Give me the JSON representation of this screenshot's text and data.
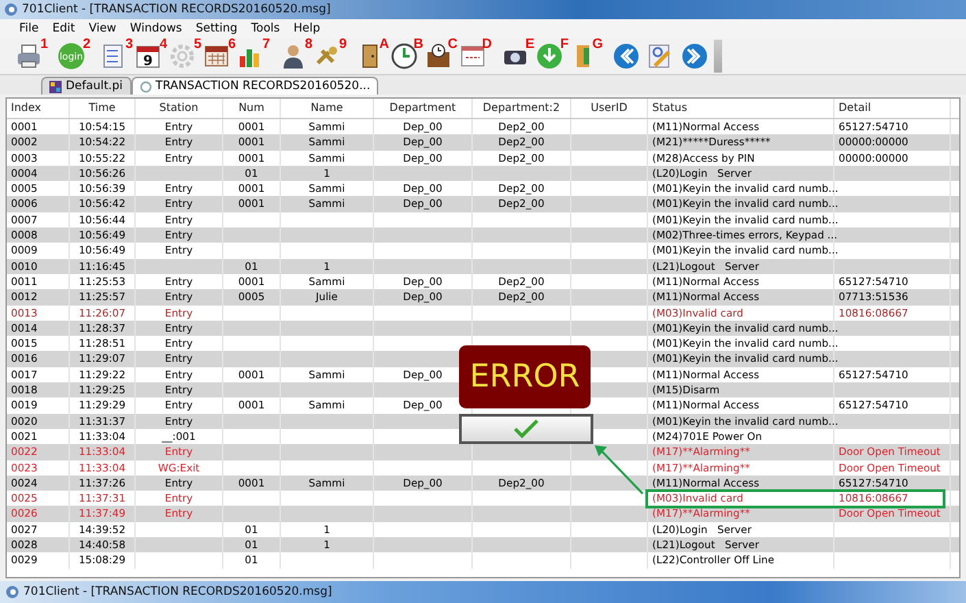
{
  "window": {
    "title": "701Client - [TRANSACTION RECORDS20160520.msg]"
  },
  "menu": [
    "File",
    "Edit",
    "View",
    "Windows",
    "Setting",
    "Tools",
    "Help"
  ],
  "toolbar": [
    {
      "kind": "printer",
      "label": "1"
    },
    {
      "kind": "login",
      "label": "2",
      "glyph": "login"
    },
    {
      "kind": "checklist",
      "label": "3"
    },
    {
      "kind": "calendar-day",
      "label": "4",
      "glyph": "9"
    },
    {
      "kind": "gear",
      "label": "5",
      "disabled": true
    },
    {
      "kind": "calendar",
      "label": "6"
    },
    {
      "kind": "chart",
      "label": "7"
    },
    {
      "kind": "person",
      "label": "8"
    },
    {
      "kind": "keys",
      "label": "9"
    },
    {
      "kind": "door",
      "label": "A"
    },
    {
      "kind": "clock",
      "label": "B"
    },
    {
      "kind": "briefcase",
      "label": "C"
    },
    {
      "kind": "window",
      "label": "D"
    },
    {
      "kind": "camera",
      "label": "E"
    },
    {
      "kind": "download",
      "label": "F"
    },
    {
      "kind": "exit",
      "label": "G"
    },
    {
      "kind": "back"
    },
    {
      "kind": "edit"
    },
    {
      "kind": "forward"
    }
  ],
  "tabs": [
    {
      "label": "Default.pi",
      "selected": false
    },
    {
      "label": "TRANSACTION RECORDS20160520...",
      "selected": true
    }
  ],
  "table": {
    "columns": [
      "Index",
      "Time",
      "Station",
      "Num",
      "Name",
      "Department",
      "Department:2",
      "UserID",
      "Status",
      "Detail"
    ],
    "rows": [
      {
        "index": "0001",
        "time": "10:54:15",
        "station": "Entry",
        "num": "0001",
        "name": "Sammi",
        "department": "Dep_00",
        "department_2": "Dep2_00",
        "status": "(M11)Normal Access",
        "detail": "65127:54710",
        "color": "#000000",
        "highlighted": false
      },
      {
        "index": "0002",
        "time": "10:54:22",
        "station": "Entry",
        "num": "0001",
        "name": "Sammi",
        "department": "Dep_00",
        "department_2": "Dep2_00",
        "status": "(M21)*****Duress*****",
        "detail": "00000:00000",
        "color": "#000000",
        "highlighted": false
      },
      {
        "index": "0003",
        "time": "10:55:22",
        "station": "Entry",
        "num": "0001",
        "name": "Sammi",
        "department": "Dep_00",
        "department_2": "Dep2_00",
        "status": "(M28)Access by PIN",
        "detail": "00000:00000",
        "color": "#000000",
        "highlighted": false
      },
      {
        "index": "0004",
        "time": "10:56:26",
        "num": "01",
        "name": "1",
        "status": "(L20)Login   Server",
        "color": "#000000",
        "highlighted": false
      },
      {
        "index": "0005",
        "time": "10:56:39",
        "station": "Entry",
        "num": "0001",
        "name": "Sammi",
        "department": "Dep_00",
        "department_2": "Dep2_00",
        "status": "(M01)Keyin the invalid card numb...",
        "color": "#000000",
        "highlighted": false
      },
      {
        "index": "0006",
        "time": "10:56:42",
        "station": "Entry",
        "num": "0001",
        "name": "Sammi",
        "department": "Dep_00",
        "department_2": "Dep2_00",
        "status": "(M01)Keyin the invalid card numb...",
        "color": "#000000",
        "highlighted": false
      },
      {
        "index": "0007",
        "time": "10:56:44",
        "station": "Entry",
        "status": "(M01)Keyin the invalid card numb...",
        "color": "#000000",
        "highlighted": false
      },
      {
        "index": "0008",
        "time": "10:56:49",
        "station": "Entry",
        "status": "(M02)Three-times errors, Keypad ...",
        "color": "#000000",
        "highlighted": false
      },
      {
        "index": "0009",
        "time": "10:56:49",
        "station": "Entry",
        "status": "(M01)Keyin the invalid card numb...",
        "color": "#000000",
        "highlighted": false
      },
      {
        "index": "0010",
        "time": "11:16:45",
        "num": "01",
        "name": "1",
        "status": "(L21)Logout   Server",
        "color": "#000000",
        "highlighted": false
      },
      {
        "index": "0011",
        "time": "11:25:53",
        "station": "Entry",
        "num": "0001",
        "name": "Sammi",
        "department": "Dep_00",
        "department_2": "Dep2_00",
        "status": "(M11)Normal Access",
        "detail": "65127:54710",
        "color": "#000000",
        "highlighted": false
      },
      {
        "index": "0012",
        "time": "11:25:57",
        "station": "Entry",
        "num": "0005",
        "name": "Julie",
        "department": "Dep_00",
        "department_2": "Dep2_00",
        "status": "(M11)Normal Access",
        "detail": "07713:51536",
        "color": "#000000",
        "highlighted": false
      },
      {
        "index": "0013",
        "time": "11:26:07",
        "station": "Entry",
        "status": "(M03)Invalid card",
        "detail": "10816:08667",
        "color": "#a52a2a",
        "highlighted": false
      },
      {
        "index": "0014",
        "time": "11:28:37",
        "station": "Entry",
        "status": "(M01)Keyin the invalid card numb...",
        "color": "#000000",
        "highlighted": false
      },
      {
        "index": "0015",
        "time": "11:28:51",
        "station": "Entry",
        "status": "(M01)Keyin the invalid card numb...",
        "color": "#000000",
        "highlighted": false
      },
      {
        "index": "0016",
        "time": "11:29:07",
        "station": "Entry",
        "status": "(M01)Keyin the invalid card numb...",
        "color": "#000000",
        "highlighted": false
      },
      {
        "index": "0017",
        "time": "11:29:22",
        "station": "Entry",
        "num": "0001",
        "name": "Sammi",
        "department": "Dep_00",
        "status": "(M11)Normal Access",
        "detail": "65127:54710",
        "color": "#000000",
        "highlighted": false
      },
      {
        "index": "0018",
        "time": "11:29:25",
        "station": "Entry",
        "status": "(M15)Disarm",
        "color": "#000000",
        "highlighted": false
      },
      {
        "index": "0019",
        "time": "11:29:29",
        "station": "Entry",
        "num": "0001",
        "name": "Sammi",
        "department": "Dep_00",
        "status": "(M11)Normal Access",
        "detail": "65127:54710",
        "color": "#000000",
        "highlighted": false
      },
      {
        "index": "0020",
        "time": "11:31:37",
        "station": "Entry",
        "status": "(M01)Keyin the invalid card numb...",
        "color": "#000000",
        "highlighted": false
      },
      {
        "index": "0021",
        "time": "11:33:04",
        "station": "__:001",
        "status": "(M24)701E Power On",
        "color": "#000000",
        "highlighted": false
      },
      {
        "index": "0022",
        "time": "11:33:04",
        "station": "Entry",
        "status": "(M17)**Alarming**",
        "detail": "Door Open Timeout",
        "color": "#e0202a",
        "highlighted": false
      },
      {
        "index": "0023",
        "time": "11:33:04",
        "station": "WG:Exit",
        "status": "(M17)**Alarming**",
        "detail": "Door Open Timeout",
        "color": "#e0202a",
        "highlighted": false
      },
      {
        "index": "0024",
        "time": "11:37:26",
        "station": "Entry",
        "num": "0001",
        "name": "Sammi",
        "department": "Dep_00",
        "department_2": "Dep2_00",
        "status": "(M11)Normal Access",
        "detail": "65127:54710",
        "color": "#000000",
        "highlighted": false
      },
      {
        "index": "0025",
        "time": "11:37:31",
        "station": "Entry",
        "status": "(M03)Invalid card",
        "detail": "10816:08667",
        "color": "#c0282e",
        "highlighted": true
      },
      {
        "index": "0026",
        "time": "11:37:49",
        "station": "Entry",
        "status": "(M17)**Alarming**",
        "detail": "Door Open Timeout",
        "color": "#e0202a",
        "highlighted": false
      },
      {
        "index": "0027",
        "time": "14:39:52",
        "num": "01",
        "name": "1",
        "status": "(L20)Login   Server",
        "color": "#000000",
        "highlighted": false
      },
      {
        "index": "0028",
        "time": "14:40:58",
        "num": "01",
        "name": "1",
        "status": "(L21)Logout   Server",
        "color": "#000000",
        "highlighted": false
      },
      {
        "index": "0029",
        "time": "15:08:29",
        "num": "01",
        "status": "(L22)Controller Off Line",
        "color": "#000000",
        "highlighted": false
      }
    ]
  },
  "dialog": {
    "title": "ERROR"
  },
  "taskbar": {
    "title": "701Client - [TRANSACTION RECORDS20160520.msg]"
  }
}
